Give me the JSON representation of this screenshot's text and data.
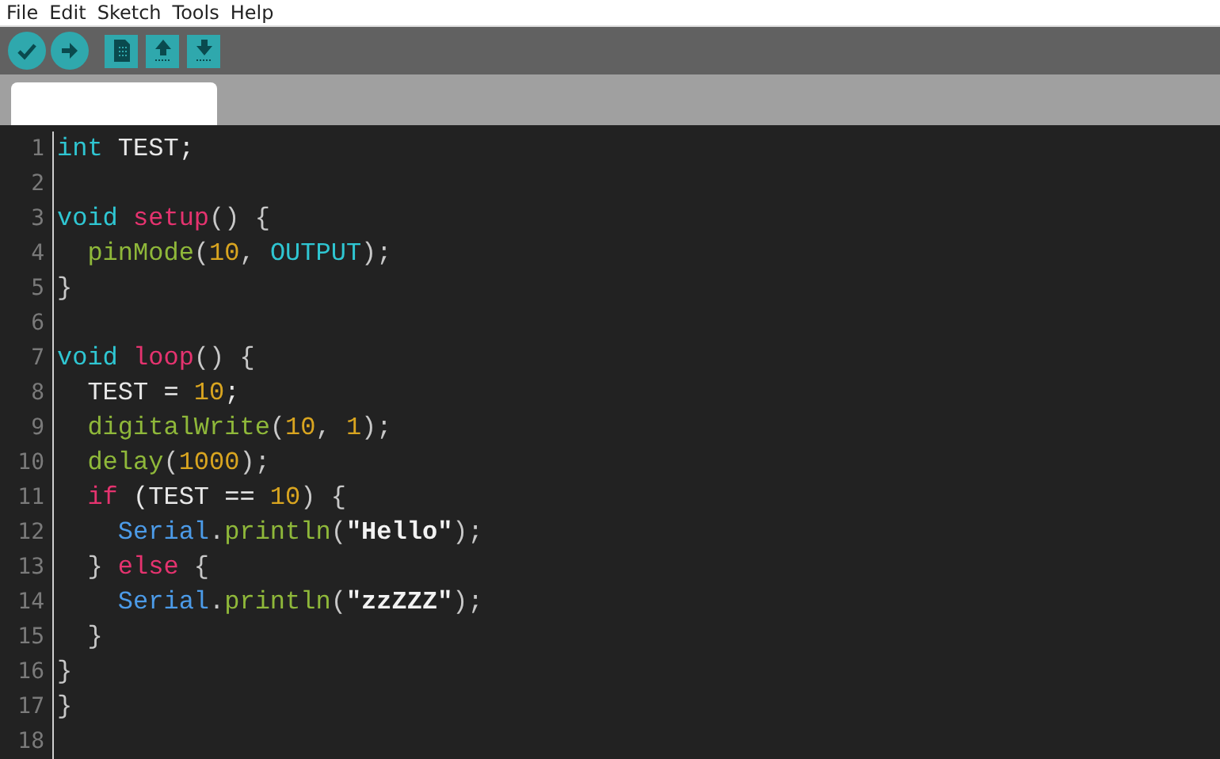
{
  "menu": [
    "File",
    "Edit",
    "Sketch",
    "Tools",
    "Help"
  ],
  "toolbar": [
    {
      "kind": "verify"
    },
    {
      "kind": "upload"
    },
    {
      "kind": "new"
    },
    {
      "kind": "open"
    },
    {
      "kind": "save"
    }
  ],
  "editor": {
    "lines": [
      {
        "number": "1",
        "tokens": [
          {
            "kind": "type",
            "text": "int"
          },
          {
            "kind": "plain",
            "text": " TEST;"
          }
        ]
      },
      {
        "number": "2"
      },
      {
        "number": "3",
        "tokens": [
          {
            "kind": "type",
            "text": "void"
          },
          {
            "kind": "fn",
            "text": " setup"
          },
          {
            "kind": "punct",
            "text": "() {"
          }
        ]
      },
      {
        "number": "4",
        "tokens": [
          {
            "kind": "call",
            "text": "  pinMode"
          },
          {
            "kind": "punct",
            "text": "("
          },
          {
            "kind": "num",
            "text": "10"
          },
          {
            "kind": "punct",
            "text": ", "
          },
          {
            "kind": "type",
            "text": "OUTPUT"
          },
          {
            "kind": "punct",
            "text": ");"
          }
        ]
      },
      {
        "number": "5",
        "tokens": [
          {
            "kind": "punct",
            "text": "}"
          }
        ]
      },
      {
        "number": "6"
      },
      {
        "number": "7",
        "tokens": [
          {
            "kind": "type",
            "text": "void"
          },
          {
            "kind": "fn",
            "text": " loop"
          },
          {
            "kind": "punct",
            "text": "() {"
          }
        ]
      },
      {
        "number": "8",
        "tokens": [
          {
            "kind": "plain",
            "text": "  TEST = "
          },
          {
            "kind": "num",
            "text": "10"
          },
          {
            "kind": "plain",
            "text": ";"
          }
        ]
      },
      {
        "number": "9",
        "tokens": [
          {
            "kind": "call",
            "text": "  digitalWrite"
          },
          {
            "kind": "punct",
            "text": "("
          },
          {
            "kind": "num",
            "text": "10"
          },
          {
            "kind": "punct",
            "text": ", "
          },
          {
            "kind": "num",
            "text": "1"
          },
          {
            "kind": "punct",
            "text": ");"
          }
        ]
      },
      {
        "number": "10",
        "tokens": [
          {
            "kind": "call",
            "text": "  delay"
          },
          {
            "kind": "punct",
            "text": "("
          },
          {
            "kind": "num",
            "text": "1000"
          },
          {
            "kind": "punct",
            "text": ");"
          }
        ]
      },
      {
        "number": "11",
        "tokens": [
          {
            "kind": "fn",
            "text": "  if"
          },
          {
            "kind": "plain",
            "text": " (TEST == "
          },
          {
            "kind": "num",
            "text": "10"
          },
          {
            "kind": "punct",
            "text": ") {"
          }
        ]
      },
      {
        "number": "12",
        "tokens": [
          {
            "kind": "obj",
            "text": "    Serial"
          },
          {
            "kind": "punct",
            "text": "."
          },
          {
            "kind": "call",
            "text": "println"
          },
          {
            "kind": "punct",
            "text": "("
          },
          {
            "kind": "str",
            "text": "\"Hello\""
          },
          {
            "kind": "punct",
            "text": ");"
          }
        ]
      },
      {
        "number": "13",
        "tokens": [
          {
            "kind": "punct",
            "text": "  } "
          },
          {
            "kind": "fn",
            "text": "else"
          },
          {
            "kind": "punct",
            "text": " {"
          }
        ]
      },
      {
        "number": "14",
        "tokens": [
          {
            "kind": "obj",
            "text": "    Serial"
          },
          {
            "kind": "punct",
            "text": "."
          },
          {
            "kind": "call",
            "text": "println"
          },
          {
            "kind": "punct",
            "text": "("
          },
          {
            "kind": "str",
            "text": "\"zzZZZ\""
          },
          {
            "kind": "punct",
            "text": ");"
          }
        ]
      },
      {
        "number": "15",
        "tokens": [
          {
            "kind": "punct",
            "text": "  }"
          }
        ]
      },
      {
        "number": "16",
        "tokens": [
          {
            "kind": "punct",
            "text": "}"
          }
        ]
      },
      {
        "number": "17",
        "tokens": [
          {
            "kind": "punct",
            "text": "}"
          }
        ]
      },
      {
        "number": "18"
      }
    ]
  }
}
